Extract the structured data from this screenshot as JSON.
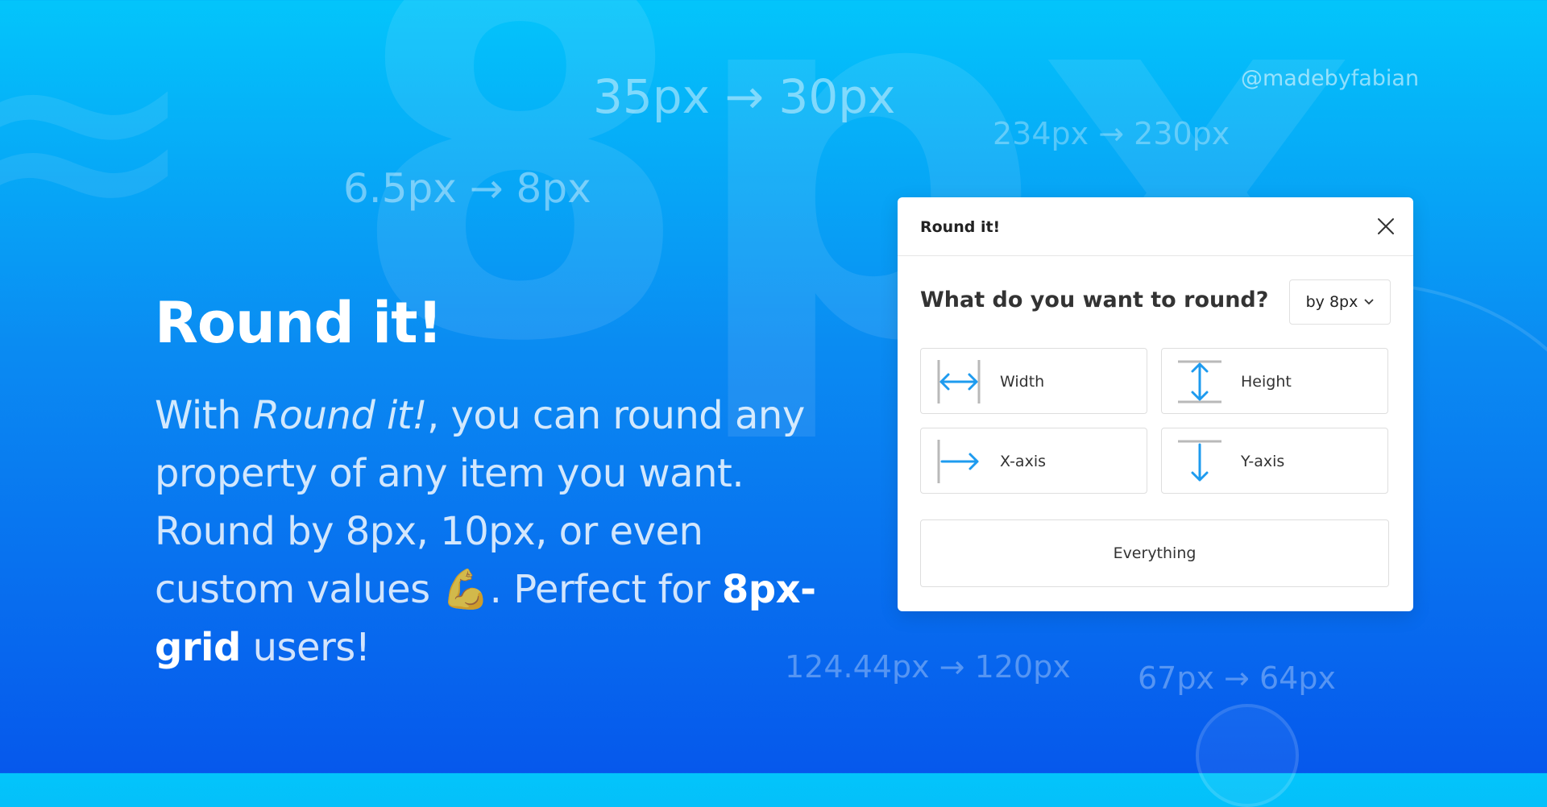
{
  "background": {
    "floating_labels": [
      "35px → 30px",
      "234px → 230px",
      "6.5px → 8px",
      "124.44px → 120px",
      "67px → 64px"
    ],
    "handle": "@madebyfabian",
    "decor_glyph_tilde": "≈",
    "decor_glyph_big": "8px"
  },
  "hero": {
    "title": "Round it!",
    "body": {
      "p1": "With ",
      "p1_em": "Round it!",
      "p2": ", you can round any property of any item you want. Round by 8px, 10px, or even custom values ",
      "emoji": "💪",
      "p3": ". Perfect for ",
      "strong": "8px-grid",
      "p4": " users!"
    }
  },
  "dialog": {
    "title": "Round it!",
    "question": "What do you want to round?",
    "select_value": "by 8px",
    "options": [
      {
        "label": "Width",
        "icon": "width-icon"
      },
      {
        "label": "Height",
        "icon": "height-icon"
      },
      {
        "label": "X-axis",
        "icon": "x-axis-icon"
      },
      {
        "label": "Y-axis",
        "icon": "y-axis-icon"
      }
    ],
    "everything_label": "Everything"
  },
  "colors": {
    "accent": "#1e9bef",
    "guide": "#b9b9b9",
    "bg_top": "#03c5fb",
    "bg_bottom": "#0658ec"
  }
}
